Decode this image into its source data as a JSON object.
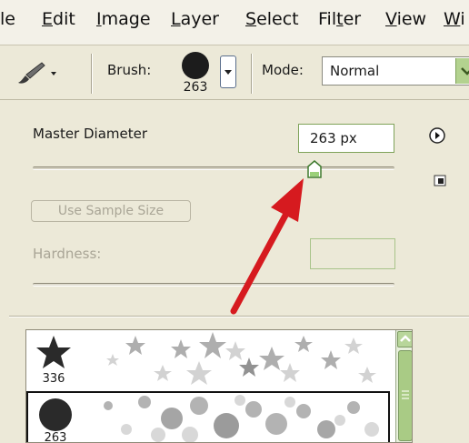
{
  "menubar": {
    "items": [
      {
        "pre": "",
        "ul": "",
        "post": "le"
      },
      {
        "pre": "",
        "ul": "E",
        "post": "dit"
      },
      {
        "pre": "",
        "ul": "I",
        "post": "mage"
      },
      {
        "pre": "",
        "ul": "L",
        "post": "ayer"
      },
      {
        "pre": "",
        "ul": "S",
        "post": "elect"
      },
      {
        "pre": "Fil",
        "ul": "t",
        "post": "er"
      },
      {
        "pre": "",
        "ul": "V",
        "post": "iew"
      },
      {
        "pre": "",
        "ul": "W",
        "post": "i"
      }
    ]
  },
  "options": {
    "brush_label": "Brush:",
    "brush_size": "263",
    "mode_label": "Mode:",
    "mode_value": "Normal"
  },
  "panel": {
    "master_diameter_label": "Master Diameter",
    "master_diameter_value": "263 px",
    "use_sample_size_label": "Use Sample Size",
    "hardness_label": "Hardness:"
  },
  "brush_list": {
    "rows": [
      {
        "size": "336",
        "shape": "star"
      },
      {
        "size": "263",
        "shape": "circle"
      }
    ]
  },
  "colors": {
    "annotation_arrow": "#d61a1f",
    "accent_green": "#a9cb85"
  }
}
